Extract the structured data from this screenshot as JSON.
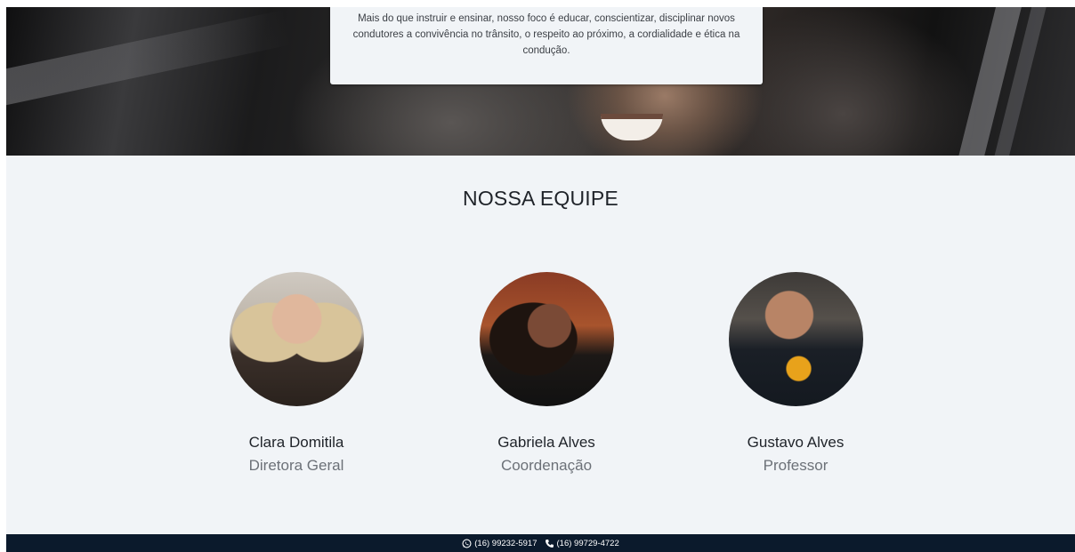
{
  "intro": {
    "text": "Mais do que instruir e ensinar, nosso foco é educar, conscientizar, disciplinar novos condutores a convivência no trânsito, o respeito ao próximo, a cordialidade e ética na condução."
  },
  "team": {
    "title": "NOSSA EQUIPE",
    "members": [
      {
        "name": "Clara Domitila",
        "role": "Diretora Geral"
      },
      {
        "name": "Gabriela Alves",
        "role": "Coordenação"
      },
      {
        "name": "Gustavo Alves",
        "role": "Professor"
      }
    ]
  },
  "footer": {
    "whatsapp_icon": "whatsapp-icon",
    "whatsapp": "(16) 99232-5917",
    "phone_icon": "phone-icon",
    "phone": "(16) 99729-4722"
  },
  "colors": {
    "footer_bg": "#0b1a2c",
    "page_bg": "#f1f4f7"
  }
}
